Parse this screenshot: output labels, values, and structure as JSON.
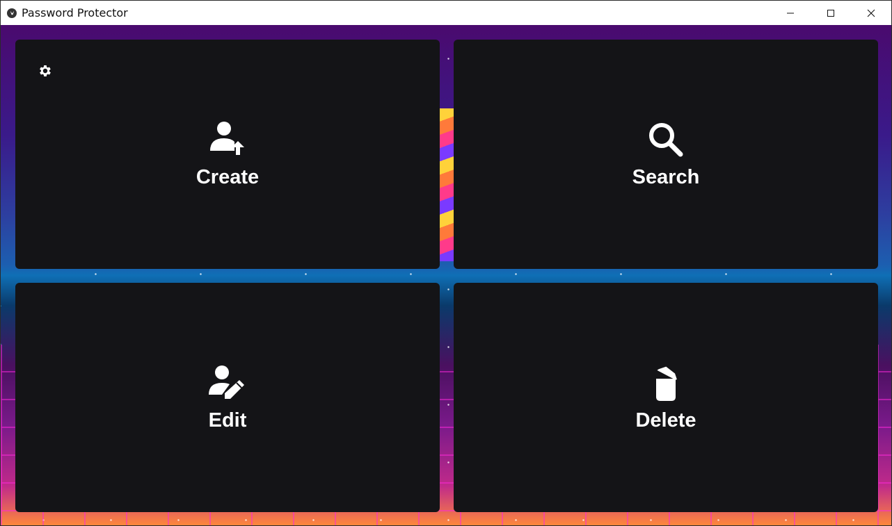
{
  "window": {
    "title": "Password Protector",
    "app_icon": "kivy-logo-icon",
    "controls": [
      "minimize-icon",
      "maximize-icon",
      "close-icon"
    ]
  },
  "settings": {
    "icon": "gear-icon"
  },
  "actions": {
    "create": {
      "label": "Create",
      "icon": "account-arrow-up-icon"
    },
    "search": {
      "label": "Search",
      "icon": "magnify-icon"
    },
    "edit": {
      "label": "Edit",
      "icon": "account-edit-icon"
    },
    "delete": {
      "label": "Delete",
      "icon": "delete-empty-icon"
    }
  },
  "colors": {
    "card_background": "#141417",
    "label": "#ffffff",
    "titlebar": "#ffffff"
  }
}
